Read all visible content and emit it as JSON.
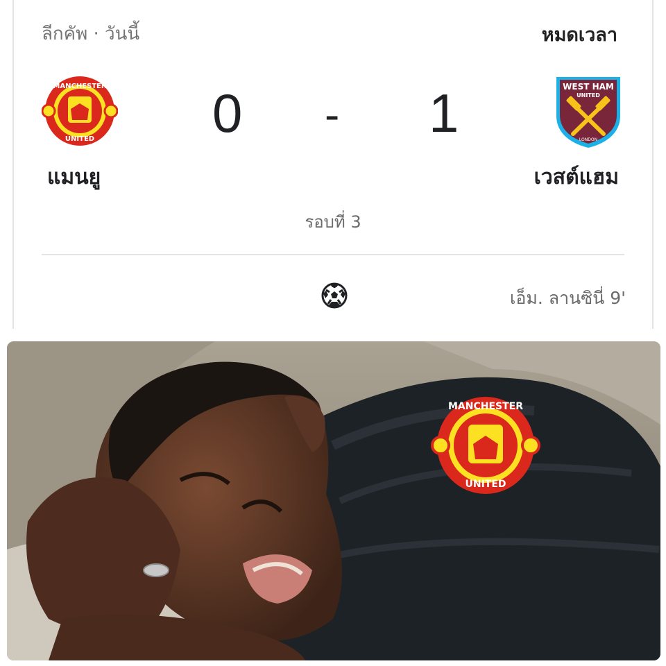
{
  "header": {
    "league": "ลีกคัพ · วันนี้",
    "status": "หมดเวลา"
  },
  "match": {
    "home": {
      "name": "แมนยู",
      "score": "0",
      "crest": "manchester-united-crest",
      "crest_text_top": "MANCHESTER",
      "crest_text_bottom": "UNITED"
    },
    "separator": "-",
    "away": {
      "name": "เวสต์แฮม",
      "score": "1",
      "crest": "west-ham-united-crest",
      "crest_text_top": "WEST HAM",
      "crest_text_mid": "UNITED",
      "crest_text_bottom": "LONDON"
    },
    "round": "รอบที่ 3"
  },
  "events": [
    {
      "icon": "soccer-ball-icon",
      "scorer": "เอ็ม. ลานซินี่ 9'"
    }
  ],
  "photo": {
    "subject": "crying-man-with-manchester-united-jersey",
    "badge_text_top": "MANCHESTER",
    "badge_text_bottom": "UNITED"
  },
  "colors": {
    "mu_red": "#DA291C",
    "mu_yellow": "#FBE122",
    "whu_claret": "#7A263A",
    "whu_blue": "#1BB1E7"
  }
}
